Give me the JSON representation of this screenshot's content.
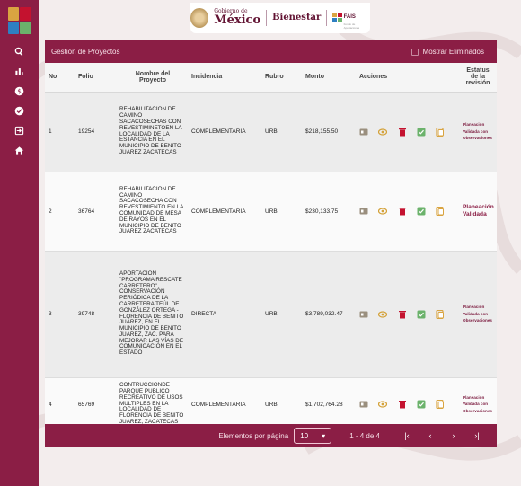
{
  "header": {
    "gob_small": "Gobierno de",
    "gob_big": "México",
    "bienestar": "Bienestar",
    "fais": "FAIS",
    "fais_sub": "Fondo de Aportaciones"
  },
  "colors": {
    "primary": "#8b1e45",
    "action_info": "#9a8f7e",
    "action_view": "#d4a23a",
    "action_delete": "#c4122f",
    "action_check": "#6bb26b",
    "action_doc": "#d9a441"
  },
  "toolbar": {
    "title": "Gestión de Proyectos",
    "show_deleted_label": "Mostrar Eliminados"
  },
  "table": {
    "headers": {
      "no": "No",
      "folio": "Folio",
      "nombre": "Nombre del Proyecto",
      "incidencia": "Incidencia",
      "rubro": "Rubro",
      "monto": "Monto",
      "acciones": "Acciones",
      "estatus": "Estatus de la revisión"
    },
    "rows": [
      {
        "no": "1",
        "folio": "19254",
        "nombre": "REHABILITACION DE CAMINO SACACOSECHAS CON REVESTIMINETOEN LA LOCALIDAD DE LA ESTANCIA EN EL MUNICIPIO DE BENITO JUAREZ ZACATECAS",
        "incidencia": "COMPLEMENTARIA",
        "rubro": "URB",
        "monto": "$218,155.50",
        "estatus": "Planeación Validada con Observaciones"
      },
      {
        "no": "2",
        "folio": "36764",
        "nombre": "REHABILITACION DE CAMINO SACACOSECHA CON REVESTIMIENTO EN LA COMUNIDAD DE MESA DE RAYOS EN EL MUNICIPIO DE BENITO JUAREZ ZACATECAS",
        "incidencia": "COMPLEMENTARIA",
        "rubro": "URB",
        "monto": "$230,133.75",
        "estatus": "Planeación Validada"
      },
      {
        "no": "3",
        "folio": "39748",
        "nombre": "APORTACION \"PROGRAMA RESCATE CARRETERO\" CONSERVACIÓN PERIÓDICA DE LA CARRETERA TEÚL DE GONZÁLEZ ORTEGA - FLORENCIA DE BENITO JUÁREZ, EN EL MUNICIPIO DE BENITO JUÁREZ, ZAC. PARA MEJORAR LAS VÍAS DE COMUNICACIÓN EN EL ESTADO",
        "incidencia": "DIRECTA",
        "rubro": "URB",
        "monto": "$3,789,032.47",
        "estatus": "Planeación Validada con Observaciones"
      },
      {
        "no": "4",
        "folio": "65769",
        "nombre": "CONTRUCCIONDE PARQUE PUBLICO RECREATIVO DE USOS MULTIPLES EN LA LOCALIDAD DE FLORENCIA DE BENITO JUAREZ, ZACATECAS",
        "incidencia": "COMPLEMENTARIA",
        "rubro": "URB",
        "monto": "$1,702,764.28",
        "estatus": "Planeación Validada con Observaciones"
      }
    ]
  },
  "paginator": {
    "items_per_page_label": "Elementos por página",
    "page_size": "10",
    "range": "1 - 4 de 4",
    "first": "|<",
    "prev": "<",
    "next": ">",
    "last": ">|"
  }
}
